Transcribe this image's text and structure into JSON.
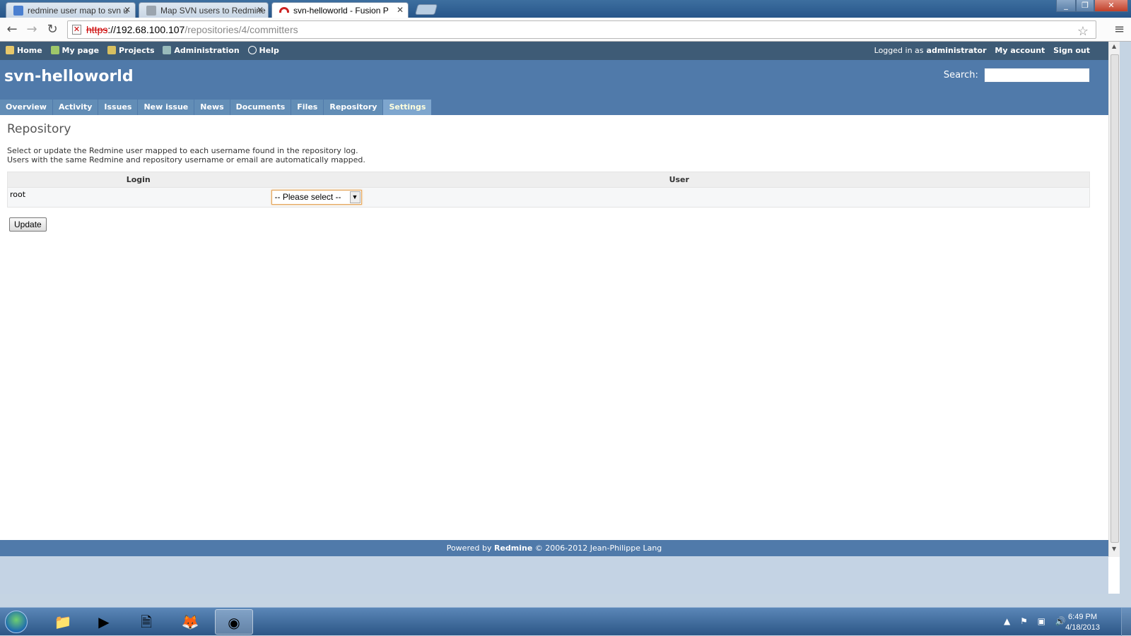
{
  "browser": {
    "tabs": [
      {
        "title": "redmine user map to svn u",
        "active": false,
        "icon": "google-icon"
      },
      {
        "title": "Map SVN users to Redmine",
        "active": false,
        "icon": "stackexchange-icon"
      },
      {
        "title": "svn-helloworld - Fusion P",
        "active": true,
        "icon": "redmine-icon"
      }
    ],
    "url_scheme": "https",
    "url_rest": "://",
    "url_host": "192.68.100.107",
    "url_path": "/repositories/4/committers"
  },
  "top_menu": {
    "items": [
      "Home",
      "My page",
      "Projects",
      "Administration",
      "Help"
    ],
    "logged_in_prefix": "Logged in as",
    "logged_in_user": "administrator",
    "my_account": "My account",
    "sign_out": "Sign out"
  },
  "header": {
    "project_title": "svn-helloworld",
    "search_label": "Search:"
  },
  "main_menu": {
    "items": [
      "Overview",
      "Activity",
      "Issues",
      "New issue",
      "News",
      "Documents",
      "Files",
      "Repository",
      "Settings"
    ],
    "selected": "Settings"
  },
  "content": {
    "title": "Repository",
    "intro_line1": "Select or update the Redmine user mapped to each username found in the repository log.",
    "intro_line2": "Users with the same Redmine and repository username or email are automatically mapped.",
    "table": {
      "headers": [
        "Login",
        "User"
      ],
      "rows": [
        {
          "login": "root",
          "user_select": "-- Please select --"
        }
      ]
    },
    "update_button": "Update"
  },
  "footer": {
    "prefix": "Powered by",
    "brand": "Redmine",
    "suffix": "© 2006-2012 Jean-Philippe Lang"
  },
  "taskbar": {
    "time": "6:49 PM",
    "date": "4/18/2013"
  }
}
